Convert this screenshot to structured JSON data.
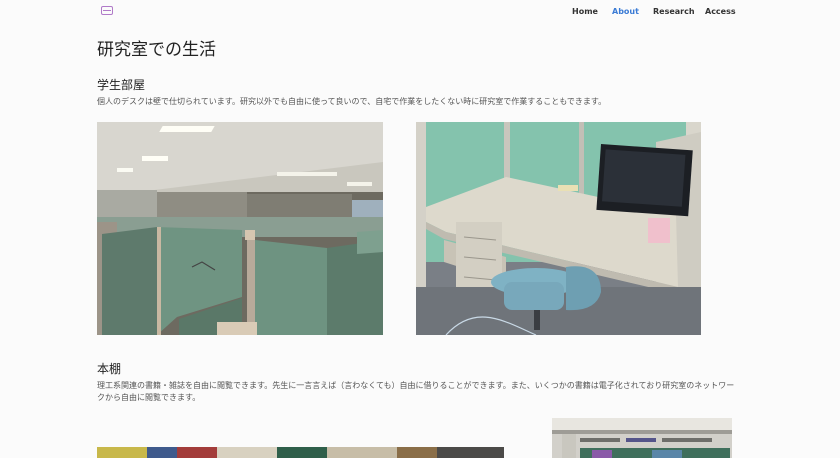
{
  "nav": {
    "logo": "lab-logo-icon",
    "items": [
      {
        "label": "Home",
        "active": false
      },
      {
        "label": "About",
        "active": true
      },
      {
        "label": "Research",
        "active": false
      },
      {
        "label": "Access",
        "active": false
      }
    ],
    "accent_color": "#3a7bd5"
  },
  "page": {
    "title": "研究室での生活"
  },
  "sections": [
    {
      "title": "学生部屋",
      "text": "個人のデスクは壁で仕切られています。研究以外でも自由に使って良いので、自宅で作業をしたくない時に研究室で作業することもできます。"
    },
    {
      "title": "本棚",
      "text": "理工系関連の書籍・雑誌を自由に閲覧できます。先生に一言言えば（言わなくても）自由に借りることができます。また、いくつかの書籍は電子化されており研究室のネットワークから自由に閲覧できます。"
    }
  ]
}
